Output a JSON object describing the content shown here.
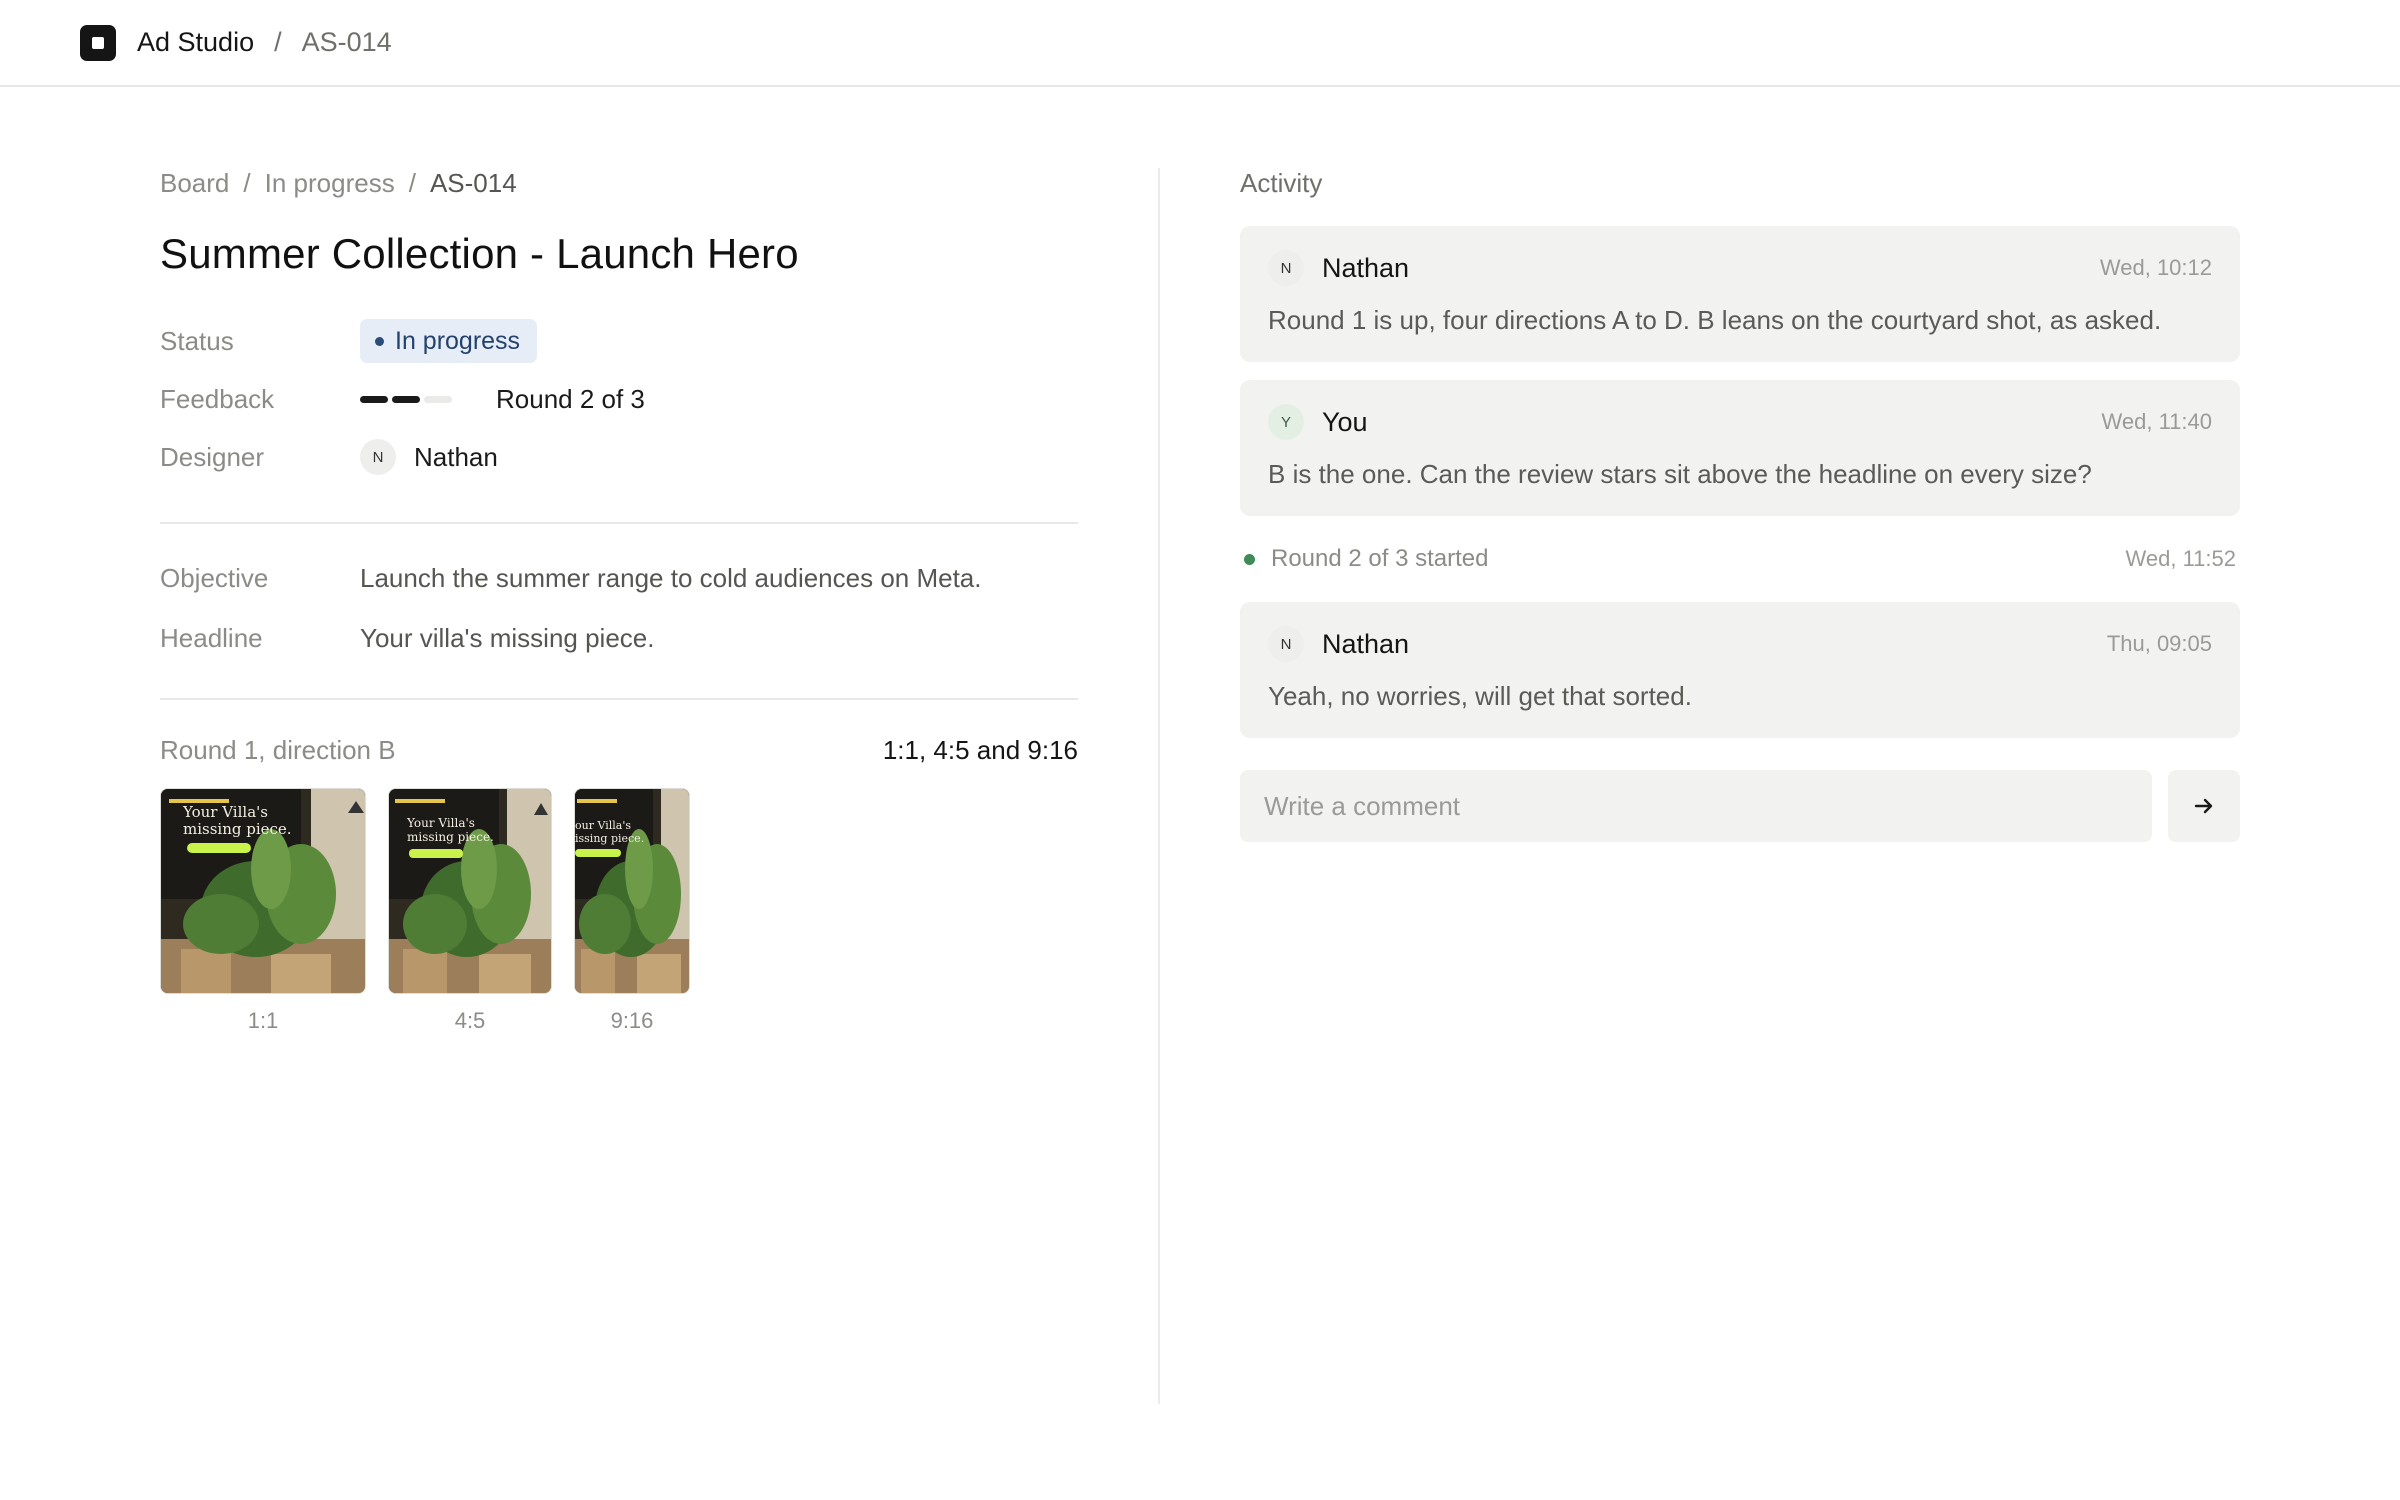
{
  "topbar": {
    "app_title": "Ad Studio",
    "separator": "/",
    "item_id": "AS-014"
  },
  "breadcrumb": {
    "items": [
      "Board",
      "In progress",
      "AS-014"
    ],
    "separator": "/"
  },
  "page_title": "Summer Collection - Launch Hero",
  "properties": {
    "status": {
      "label": "Status",
      "value": "In progress",
      "color": "#2c4d7c",
      "background": "#e6edf6"
    },
    "feedback": {
      "label": "Feedback",
      "value": "Round 2 of 3",
      "current_round": 2,
      "total_rounds": 3
    },
    "designer": {
      "label": "Designer",
      "initial": "N",
      "name": "Nathan"
    }
  },
  "brief": {
    "objective": {
      "label": "Objective",
      "value": "Launch the summer range to cold audiences on Meta."
    },
    "headline": {
      "label": "Headline",
      "value": "Your villa's missing piece."
    }
  },
  "creatives": {
    "title": "Round 1, direction B",
    "ratios_text": "1:1, 4:5 and 9:16",
    "thumbnails": [
      {
        "label": "1:1",
        "caption_lines": [
          "Your Villa's",
          "missing piece."
        ]
      },
      {
        "label": "4:5",
        "caption_lines": [
          "Your Villa's",
          "missing piece."
        ]
      },
      {
        "label": "9:16",
        "caption_lines": [
          "our Villa's",
          "issing piece."
        ]
      }
    ]
  },
  "activity": {
    "title": "Activity",
    "comments": [
      {
        "initial": "N",
        "author": "Nathan",
        "time": "Wed, 10:12",
        "body": "Round 1 is up, four directions A to D. B leans on the courtyard shot, as asked."
      },
      {
        "initial": "Y",
        "author": "You",
        "time": "Wed, 11:40",
        "body": "B is the one. Can the review stars sit above the headline on every size?"
      }
    ],
    "event": {
      "text": "Round 2 of 3 started",
      "time": "Wed, 11:52",
      "color": "#3f8a58"
    },
    "comments_after": [
      {
        "initial": "N",
        "author": "Nathan",
        "time": "Thu, 09:05",
        "body": "Yeah, no worries, will get that sorted."
      }
    ],
    "composer": {
      "placeholder": "Write a comment",
      "send_icon": "arrow-right-icon"
    }
  }
}
